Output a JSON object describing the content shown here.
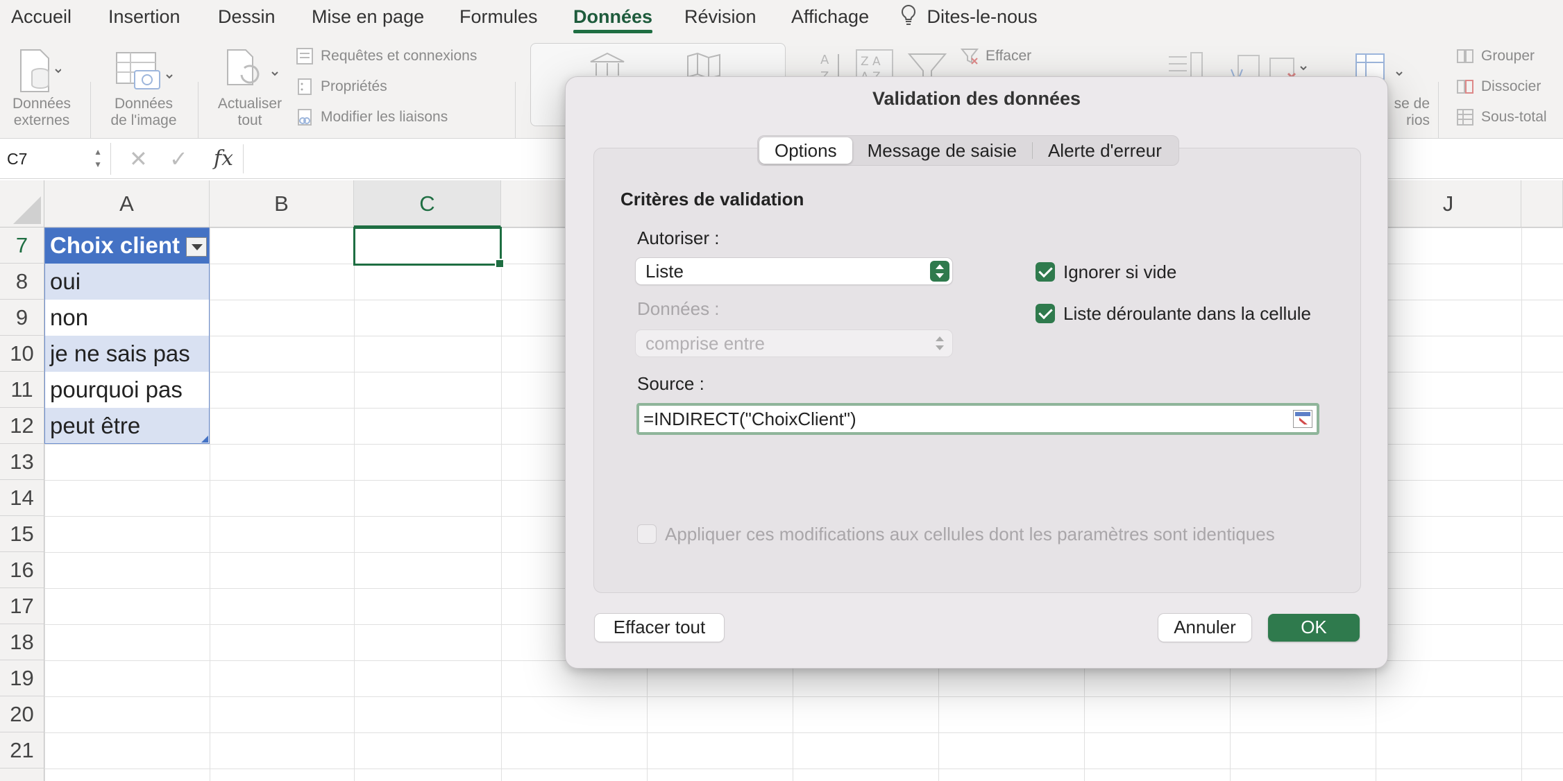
{
  "ribbon_tabs": [
    {
      "label": "Accueil",
      "active": false
    },
    {
      "label": "Insertion",
      "active": false
    },
    {
      "label": "Dessin",
      "active": false
    },
    {
      "label": "Mise en page",
      "active": false
    },
    {
      "label": "Formules",
      "active": false
    },
    {
      "label": "Données",
      "active": true
    },
    {
      "label": "Révision",
      "active": false
    },
    {
      "label": "Affichage",
      "active": false
    }
  ],
  "tell_me": "Dites-le-nous",
  "ribbon": {
    "donnees_externes": [
      "Données",
      "externes"
    ],
    "donnees_image": [
      "Données",
      "de l'image"
    ],
    "actualiser": [
      "Actualiser",
      "tout"
    ],
    "requetes": "Requêtes et connexions",
    "proprietes": "Propriétés",
    "liaisons": "Modifier les liaisons",
    "effacer": "Effacer",
    "scenarios_partial": [
      "se de",
      "rios"
    ],
    "grouper": "Grouper",
    "dissocier": "Dissocier",
    "sous_total": "Sous-total"
  },
  "formula_bar": {
    "name_box": "C7",
    "fx": "fx"
  },
  "columns": [
    "A",
    "B",
    "C",
    "J"
  ],
  "rows": [
    "7",
    "8",
    "9",
    "10",
    "11",
    "12",
    "13",
    "14",
    "15",
    "16",
    "17",
    "18",
    "19",
    "20",
    "21"
  ],
  "table": {
    "header": "Choix client",
    "values": [
      "oui",
      "non",
      "je ne sais pas",
      "pourquoi pas",
      "peut être"
    ]
  },
  "dialog": {
    "title": "Validation des données",
    "tabs": [
      {
        "label": "Options",
        "active": true
      },
      {
        "label": "Message de saisie",
        "active": false
      },
      {
        "label": "Alerte d'erreur",
        "active": false
      }
    ],
    "section_title": "Critères de validation",
    "allow_label": "Autoriser :",
    "allow_value": "Liste",
    "data_label": "Données :",
    "data_value": "comprise entre",
    "ignore_blank": {
      "label": "Ignorer si vide",
      "checked": true
    },
    "in_cell_dropdown": {
      "label": "Liste déroulante dans la cellule",
      "checked": true
    },
    "source_label": "Source :",
    "source_value": "=INDIRECT(\"ChoixClient\")",
    "apply_all": {
      "label": "Appliquer ces modifications aux cellules dont les paramètres sont identiques",
      "checked": false
    },
    "clear_all": "Effacer tout",
    "cancel": "Annuler",
    "ok": "OK"
  },
  "colors": {
    "accent": "#1e6e42",
    "table_header": "#4472c4",
    "table_band": "#d9e1f2",
    "checkbox": "#2f7a4d"
  }
}
